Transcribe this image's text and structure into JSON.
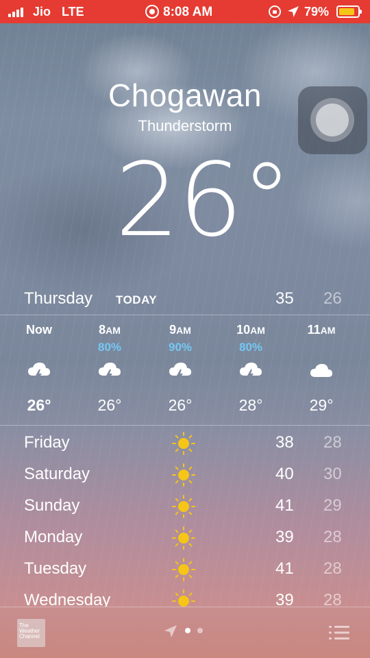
{
  "status_bar": {
    "carrier": "Jio",
    "network": "LTE",
    "time": "8:08 AM",
    "battery": "79%",
    "battery_level": 0.79,
    "bar_color": "#e53b32"
  },
  "weather": {
    "city": "Chogawan",
    "condition": "Thunderstorm",
    "temperature": "26°"
  },
  "today": {
    "day": "Thursday",
    "tag": "TODAY",
    "high": "35",
    "low": "26"
  },
  "hourly": [
    {
      "time": "Now",
      "ampm": "",
      "pop": "",
      "icon": "thunderstorm-icon",
      "temp": "26°"
    },
    {
      "time": "8",
      "ampm": "AM",
      "pop": "80%",
      "icon": "thunderstorm-icon",
      "temp": "26°"
    },
    {
      "time": "9",
      "ampm": "AM",
      "pop": "90%",
      "icon": "thunderstorm-icon",
      "temp": "26°"
    },
    {
      "time": "10",
      "ampm": "AM",
      "pop": "80%",
      "icon": "thunderstorm-icon",
      "temp": "28°"
    },
    {
      "time": "11",
      "ampm": "AM",
      "pop": "",
      "icon": "cloud-icon",
      "temp": "29°"
    }
  ],
  "daily": [
    {
      "day": "Friday",
      "icon": "sun-icon",
      "high": "38",
      "low": "28"
    },
    {
      "day": "Saturday",
      "icon": "sun-icon",
      "high": "40",
      "low": "30"
    },
    {
      "day": "Sunday",
      "icon": "sun-icon",
      "high": "41",
      "low": "29"
    },
    {
      "day": "Monday",
      "icon": "sun-icon",
      "high": "39",
      "low": "28"
    },
    {
      "day": "Tuesday",
      "icon": "sun-icon",
      "high": "41",
      "low": "28"
    },
    {
      "day": "Wednesday",
      "icon": "sun-icon",
      "high": "39",
      "low": "28"
    }
  ],
  "toolbar": {
    "logo_text": "The Weather Channel",
    "page_count": 2,
    "active_page": 0
  },
  "colors": {
    "precip": "#74c8f4",
    "sun": "#f5c518"
  }
}
